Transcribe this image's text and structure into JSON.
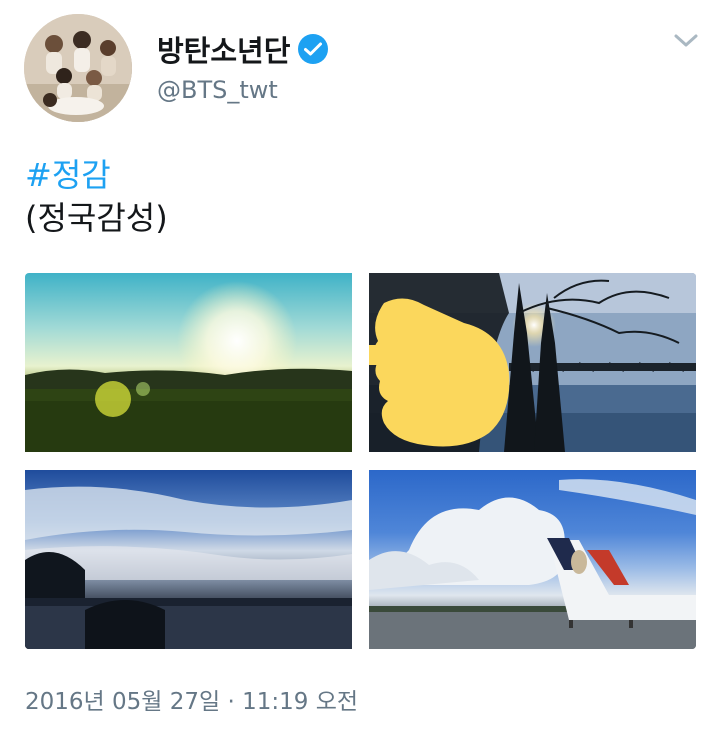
{
  "author": {
    "display_name": "방탄소년단",
    "handle": "@BTS_twt",
    "verified": true,
    "avatar_icon": "group-photo-avatar"
  },
  "tweet": {
    "hashtag": "#정감",
    "text_line2": "(정국감성)",
    "timestamp": "2016년 05월 27일 · 11:19 오전"
  },
  "media": {
    "photos": [
      {
        "subject": "sunlit-field"
      },
      {
        "subject": "lakeside-trees-bridge"
      },
      {
        "subject": "lake-cloudy-sky"
      },
      {
        "subject": "airplane-blue-sky"
      }
    ],
    "overlay_icon": "pointing-hand-emoji"
  },
  "colors": {
    "hashtag": "#1da1f2",
    "verified_badge": "#1da1f2",
    "text_primary": "#14171a",
    "text_secondary": "#657786",
    "emoji_hand": "#fbd75c"
  }
}
